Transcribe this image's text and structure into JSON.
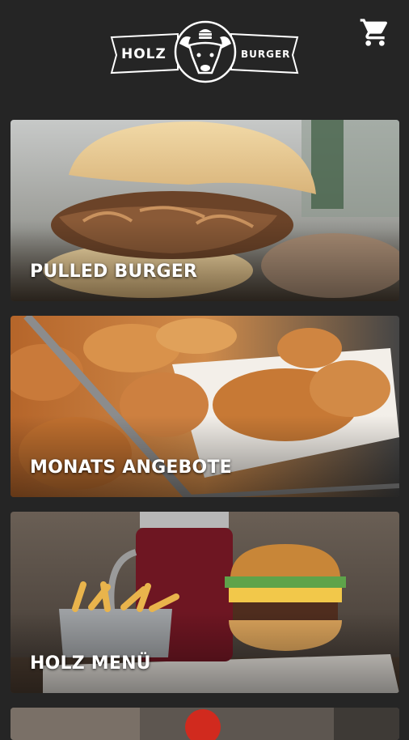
{
  "header": {
    "logo": {
      "word1": "HOLZ",
      "word2": "BURGER"
    },
    "cart_icon": "shopping-cart-icon"
  },
  "categories": [
    {
      "label": "PULLED BURGER"
    },
    {
      "label": "MONATS ANGEBOTE"
    },
    {
      "label": "HOLZ MENÜ"
    },
    {
      "label": ""
    }
  ],
  "colors": {
    "background": "#252525",
    "text": "#ffffff"
  }
}
